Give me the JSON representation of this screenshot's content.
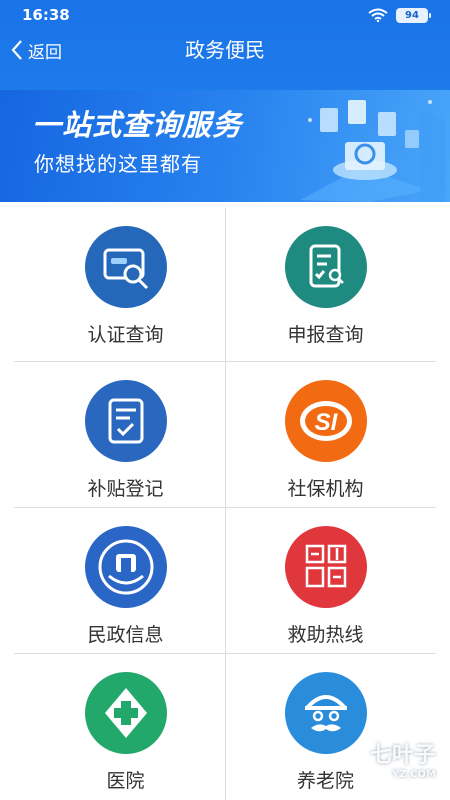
{
  "status_bar": {
    "time": "16:38",
    "battery": "94"
  },
  "header": {
    "back_label": "返回",
    "title": "政务便民"
  },
  "banner": {
    "title": "一站式查询服务",
    "subtitle": "你想找的这里都有"
  },
  "services": [
    {
      "label": "认证查询",
      "icon": "id-card-search-icon",
      "color": "#2567b8"
    },
    {
      "label": "申报查询",
      "icon": "document-search-icon",
      "color": "#1e8a80"
    },
    {
      "label": "补贴登记",
      "icon": "form-check-icon",
      "color": "#2a68c0"
    },
    {
      "label": "社保机构",
      "icon": "social-security-logo-icon",
      "color": "#f26a12"
    },
    {
      "label": "民政信息",
      "icon": "civil-affairs-emblem-icon",
      "color": "#2a66c6"
    },
    {
      "label": "救助热线",
      "icon": "civil-affairs-seal-icon",
      "color": "#e0373d"
    },
    {
      "label": "医院",
      "icon": "medical-cross-icon",
      "color": "#22a86b"
    },
    {
      "label": "养老院",
      "icon": "elderly-face-icon",
      "color": "#2a8ddc"
    }
  ],
  "watermark": {
    "text": "七叶子",
    "sub": "YZ.COM"
  }
}
